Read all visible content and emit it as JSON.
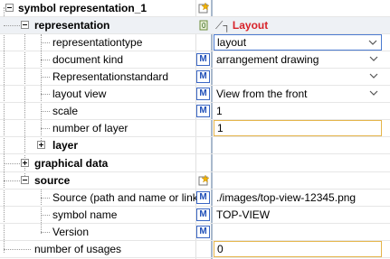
{
  "root": {
    "label": "symbol representation_1"
  },
  "representation": {
    "label": "representation",
    "link_text": "Layout",
    "properties": [
      {
        "label": "representationtype",
        "value": "layout",
        "has_m": false,
        "dropdown": true
      },
      {
        "label": "document kind",
        "value": "arrangement drawing",
        "has_m": true,
        "dropdown": true
      },
      {
        "label": "Representationstandard",
        "value": "",
        "has_m": true,
        "dropdown": true
      },
      {
        "label": "layout view",
        "value": "View from the front",
        "has_m": true,
        "dropdown": true
      },
      {
        "label": "scale",
        "value": "1",
        "has_m": true,
        "dropdown": false
      },
      {
        "label": "number of layer",
        "value": "1",
        "has_m": false,
        "dropdown": false
      }
    ],
    "layer": {
      "label": "layer"
    }
  },
  "graphical_data": {
    "label": "graphical data"
  },
  "source": {
    "label": "source",
    "properties": [
      {
        "label": "Source (path and name or link)",
        "value": "./images/top-view-12345.png",
        "has_m": true
      },
      {
        "label": "symbol name",
        "value": "TOP-VIEW",
        "has_m": true
      },
      {
        "label": "Version",
        "value": "",
        "has_m": true
      }
    ]
  },
  "usages": {
    "label": "number of usages",
    "value": "0"
  },
  "badge": {
    "m_label": "M"
  },
  "colors": {
    "accent": "#1f4fb8",
    "link": "#d8232a",
    "separator": "#a9b9cc",
    "highlight_border": "#e5b54a"
  }
}
